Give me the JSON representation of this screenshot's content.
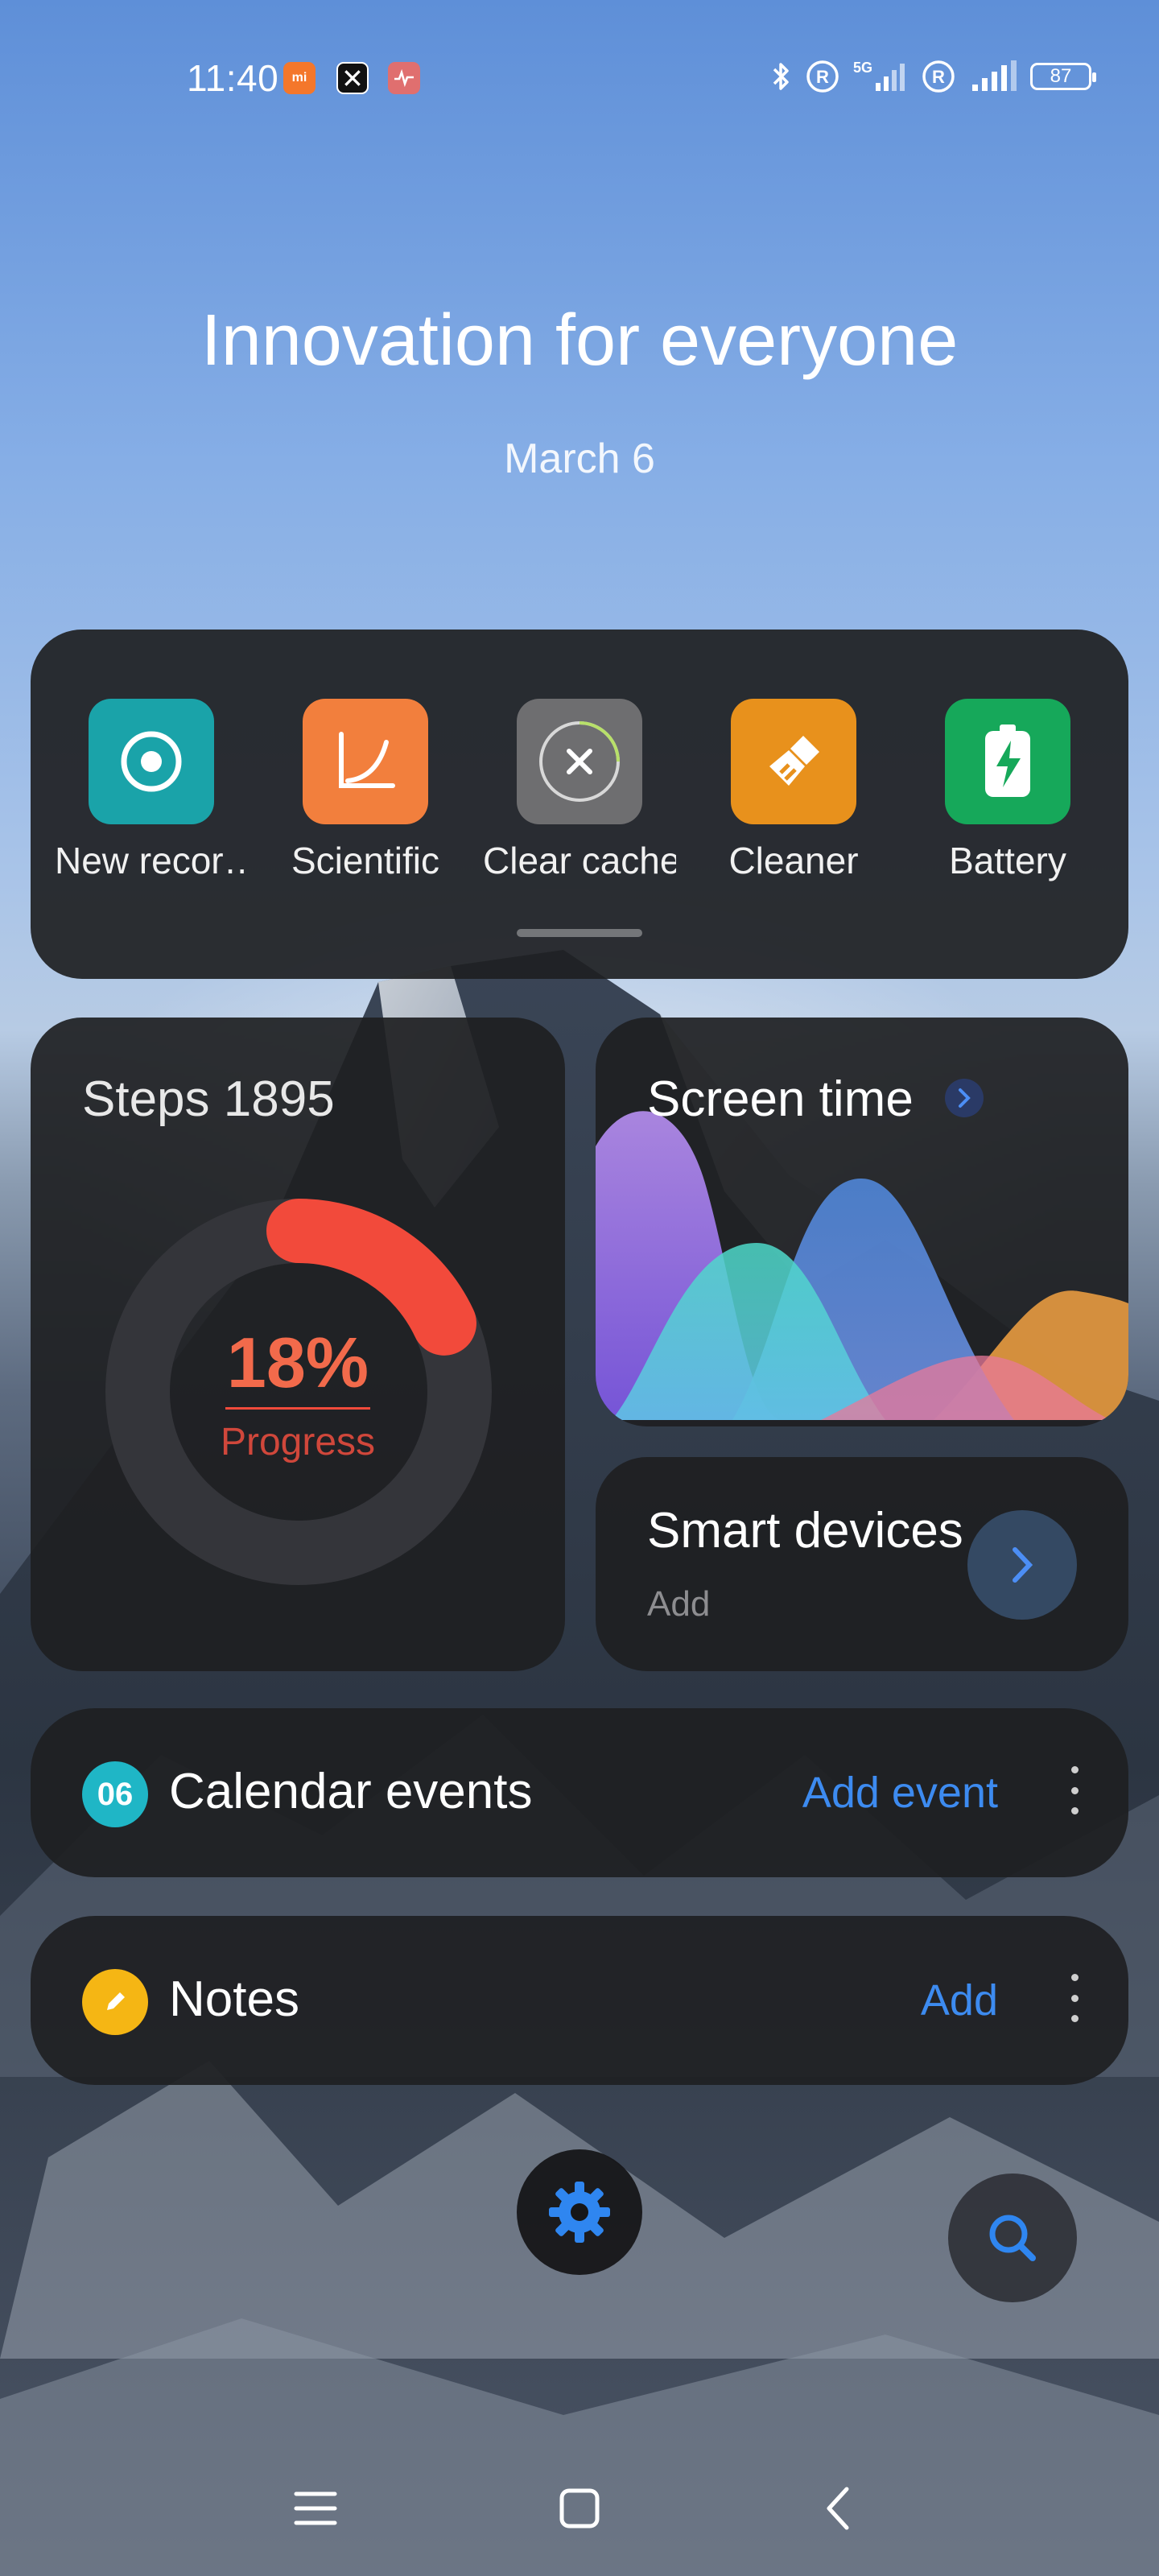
{
  "status_bar": {
    "time": "11:40",
    "app_icons": [
      "mi-icon",
      "tools-icon",
      "health-icon"
    ],
    "right_icons": [
      "bluetooth-icon",
      "roaming-icon",
      "signal-5g-icon",
      "roaming-icon",
      "signal-icon"
    ],
    "network_label": "5G",
    "battery_level": "87"
  },
  "header": {
    "headline": "Innovation for everyone",
    "date": "March 6"
  },
  "quick_actions": [
    {
      "label": "New recor…",
      "icon": "record-icon",
      "color": "#1aa3a9"
    },
    {
      "label": "Scientific",
      "icon": "graph-curve-icon",
      "color": "#f27f3d"
    },
    {
      "label": "Clear cache",
      "icon": "close-icon",
      "color": "#6e6e70"
    },
    {
      "label": "Cleaner",
      "icon": "broom-icon",
      "color": "#e8911c"
    },
    {
      "label": "Battery",
      "icon": "battery-bolt-icon",
      "color": "#16a85a"
    }
  ],
  "steps_widget": {
    "title": "Steps 1895",
    "percent": "18%",
    "progress_fraction": 0.18,
    "progress_label": "Progress",
    "accent": "#f24a3b"
  },
  "screen_time_widget": {
    "title": "Screen time"
  },
  "smart_devices_widget": {
    "title": "Smart devices",
    "subtitle": "Add"
  },
  "calendar_widget": {
    "badge": "06",
    "title": "Calendar events",
    "action": "Add event"
  },
  "notes_widget": {
    "title": "Notes",
    "action": "Add"
  },
  "dock": {
    "settings_icon": "gear-icon",
    "search_icon": "search-icon"
  },
  "nav_bar": {
    "icons": [
      "menu-icon",
      "home-icon",
      "back-icon"
    ]
  },
  "colors": {
    "link_blue": "#3d8bf0",
    "card_bg": "#1e1f22"
  }
}
